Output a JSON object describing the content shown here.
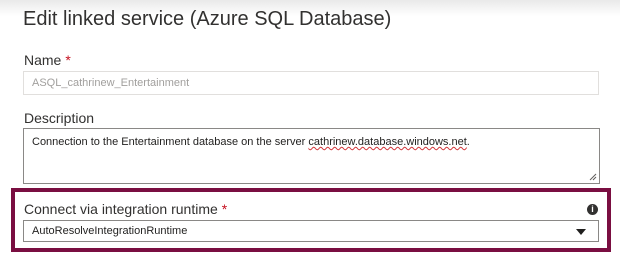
{
  "dialog": {
    "title": "Edit linked service (Azure SQL Database)"
  },
  "name_field": {
    "label": "Name",
    "required_mark": "*",
    "value": "ASQL_cathrinew_Entertainment"
  },
  "description_field": {
    "label": "Description",
    "value_prefix": "Connection to the Entertainment database on the server ",
    "value_link": "cathrinew.database.windows.net",
    "value_suffix": "."
  },
  "runtime_field": {
    "label": "Connect via integration runtime",
    "required_mark": "*",
    "info_icon": "i",
    "selected": "AutoResolveIntegrationRuntime"
  },
  "colors": {
    "highlight": "#7a0e41",
    "required": "#c50f1f"
  }
}
